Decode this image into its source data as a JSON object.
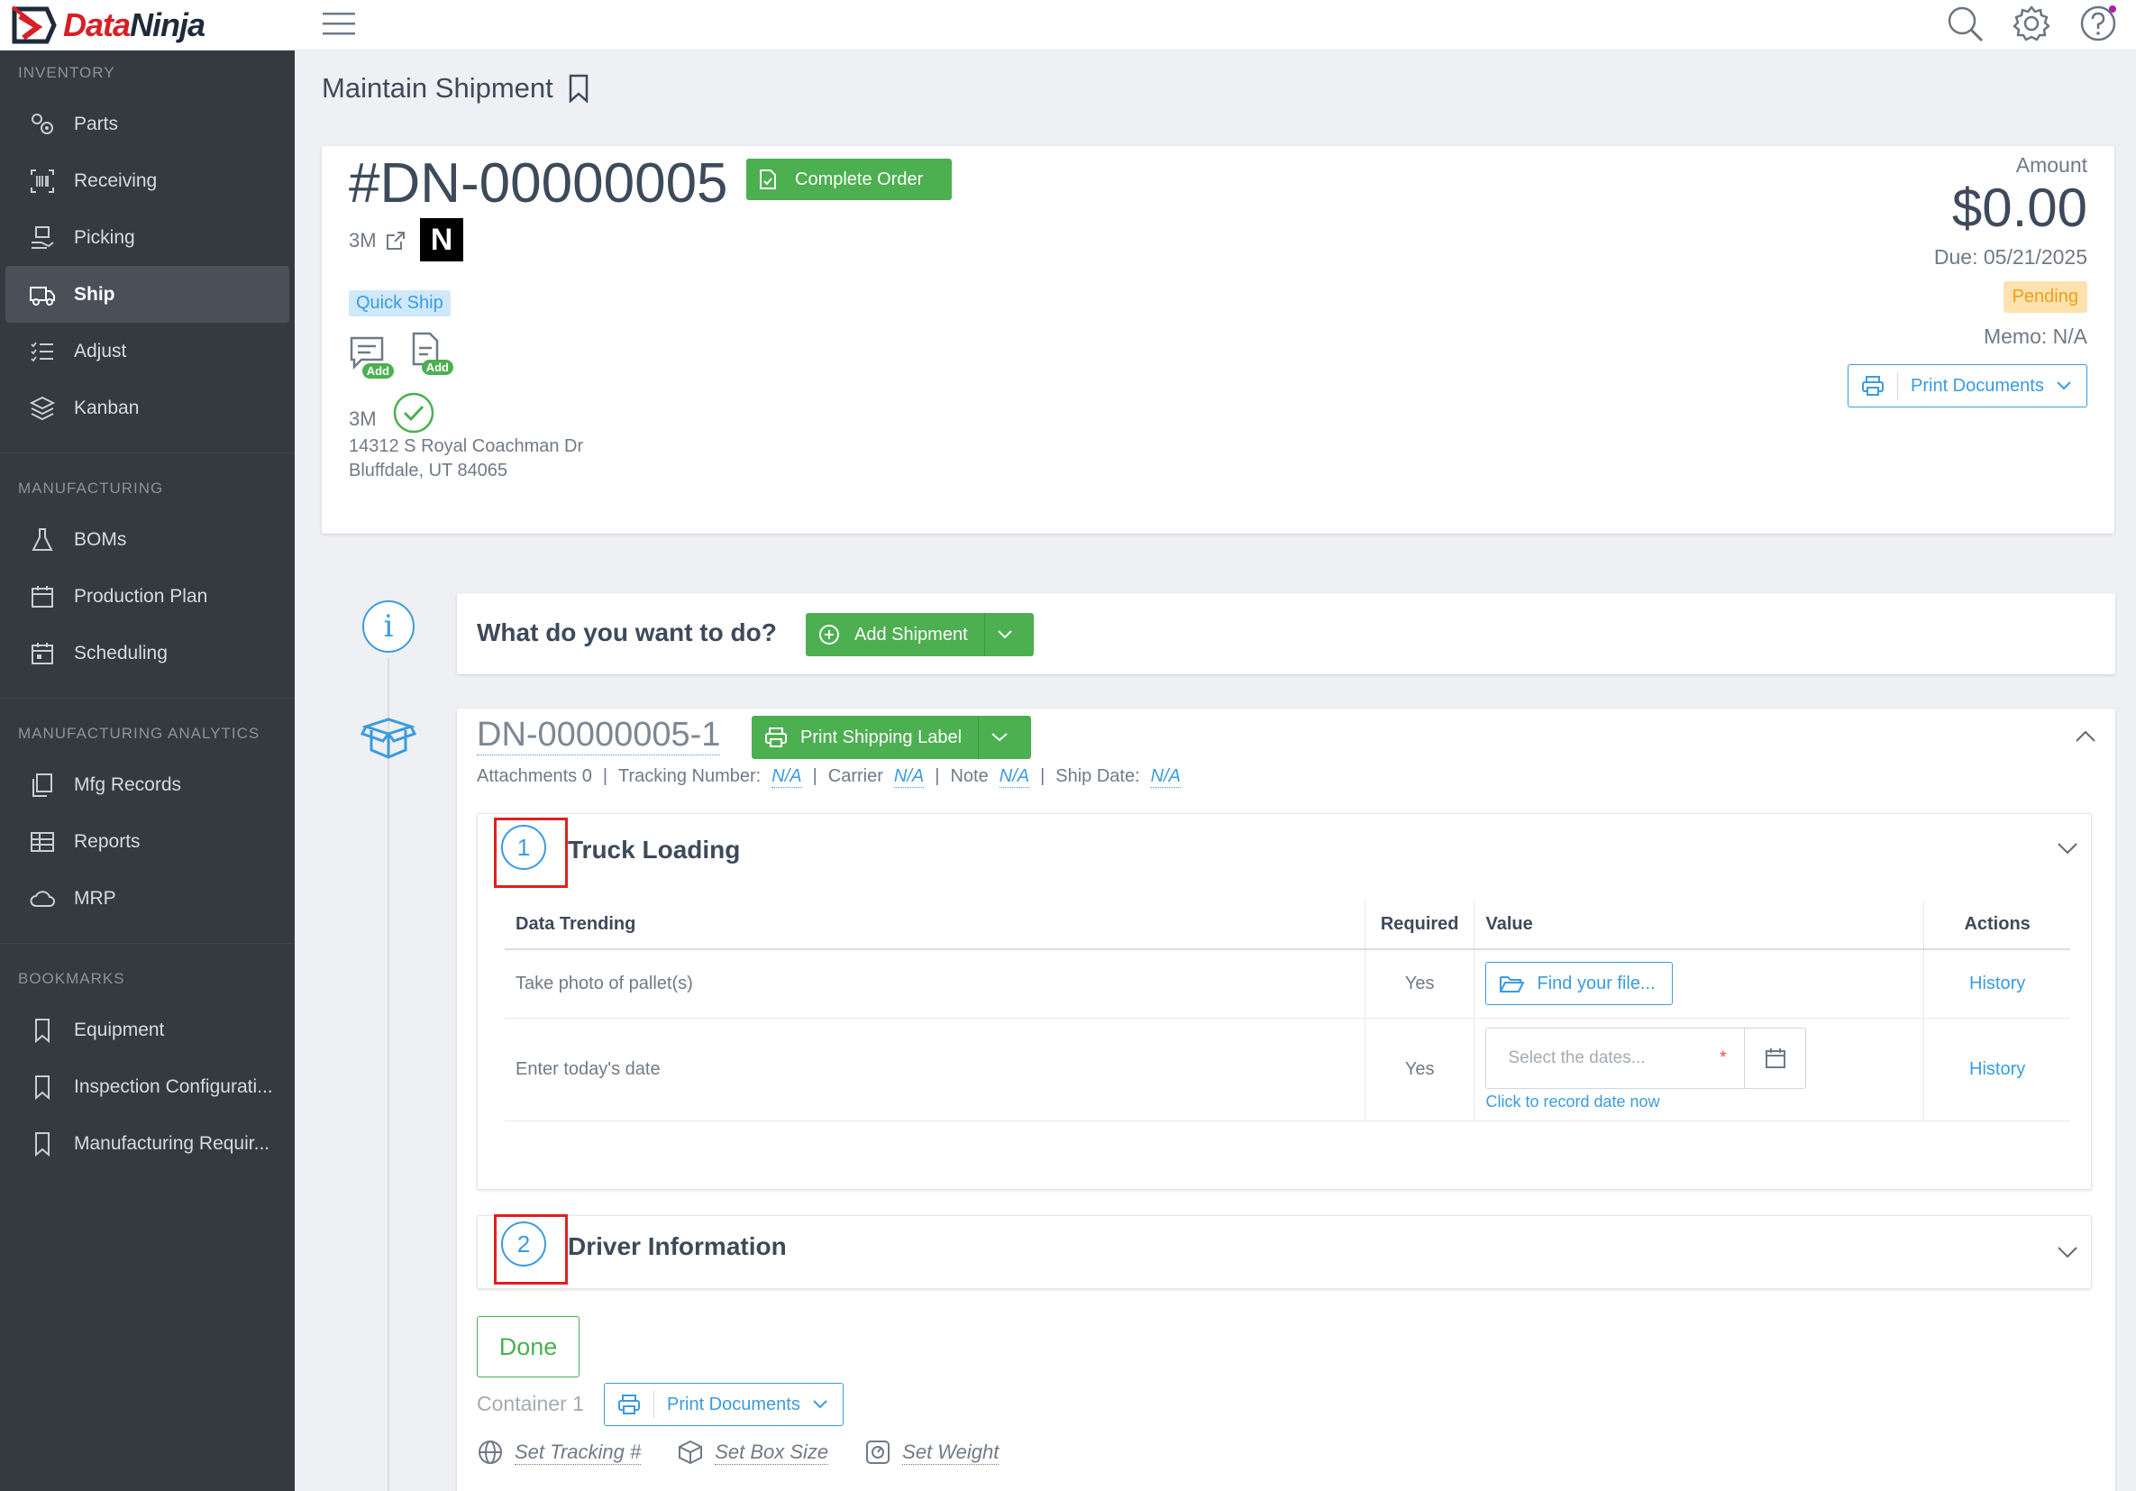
{
  "app": {
    "brand_left": "Data",
    "brand_right": "Ninja"
  },
  "sidebar": {
    "sections": [
      {
        "title": "INVENTORY",
        "items": [
          "Parts",
          "Receiving",
          "Picking",
          "Ship",
          "Adjust",
          "Kanban"
        ]
      },
      {
        "title": "MANUFACTURING",
        "items": [
          "BOMs",
          "Production Plan",
          "Scheduling"
        ]
      },
      {
        "title": "MANUFACTURING ANALYTICS",
        "items": [
          "Mfg Records",
          "Reports",
          "MRP"
        ]
      },
      {
        "title": "BOOKMARKS",
        "items": [
          "Equipment",
          "Inspection Configurati...",
          "Manufacturing Requir..."
        ]
      }
    ],
    "active": "Ship"
  },
  "page": {
    "title": "Maintain Shipment"
  },
  "order": {
    "number": "#DN-00000005",
    "complete_label": "Complete Order",
    "customer": "3M",
    "badge": "N",
    "quick_ship": "Quick Ship",
    "add_note": "Add",
    "add_doc": "Add",
    "address_name": "3M",
    "address_line1": "14312 S Royal Coachman Dr",
    "address_line2": "Bluffdale, UT 84065",
    "amount_label": "Amount",
    "amount": "$0.00",
    "due": "Due: 05/21/2025",
    "status": "Pending",
    "memo": "Memo: N/A",
    "print_docs": "Print Documents"
  },
  "what": {
    "question": "What do you want to do?",
    "add_shipment": "Add Shipment"
  },
  "shipment": {
    "number": "DN-00000005-1",
    "print_label": "Print Shipping Label",
    "attachments": "Attachments 0",
    "tracking_label": "Tracking Number:",
    "tracking_value": "N/A",
    "carrier_label": "Carrier",
    "carrier_value": "N/A",
    "note_label": "Note",
    "note_value": "N/A",
    "ship_date_label": "Ship Date:",
    "ship_date_value": "N/A",
    "steps": [
      {
        "num": "1",
        "title": "Truck Loading"
      },
      {
        "num": "2",
        "title": "Driver Information"
      }
    ],
    "table": {
      "headers": [
        "Data Trending",
        "Required",
        "Value",
        "Actions"
      ],
      "rows": [
        {
          "label": "Take photo of pallet(s)",
          "required": "Yes",
          "value": "Find your file...",
          "action": "History"
        },
        {
          "label": "Enter today's date",
          "required": "Yes",
          "value": "Select the dates...",
          "star": "*",
          "link": "Click to record date now",
          "action": "History"
        }
      ]
    },
    "done": "Done",
    "container": "Container 1",
    "container_print": "Print Documents",
    "set_tracking": "Set Tracking #",
    "set_box": "Set Box Size",
    "set_weight": "Set Weight"
  },
  "colors": {
    "accent": "#3a9be0",
    "green": "#4caf50",
    "sidebar": "#343a40",
    "pending": "#f39c12",
    "highlight": "#e02020"
  }
}
